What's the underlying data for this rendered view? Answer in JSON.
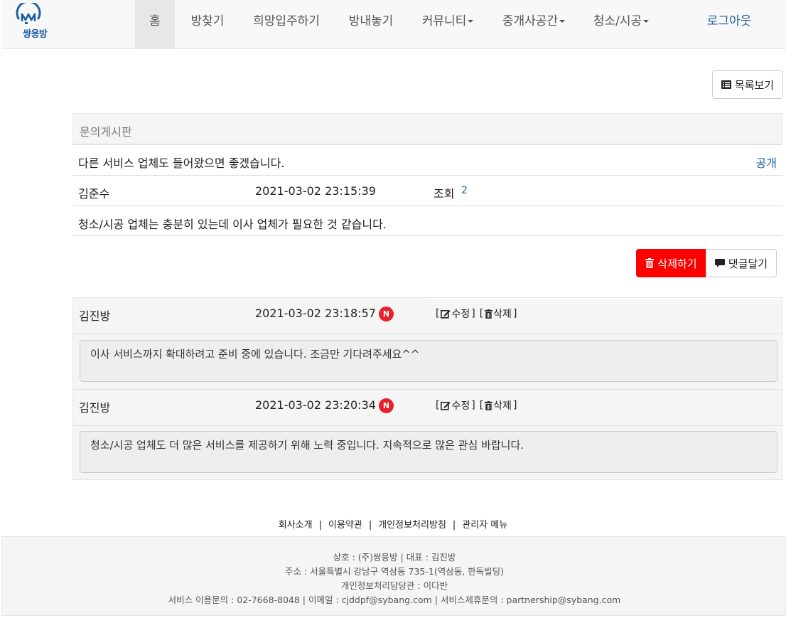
{
  "brand": {
    "name": "쌍용방"
  },
  "nav": {
    "home": "홈",
    "find_room": "방찾기",
    "wish_move": "희망입주하기",
    "list_room": "방내놓기",
    "community": "커뮤니티",
    "broker": "중개사공간",
    "cleaning": "청소/시공",
    "logout": "로그아웃"
  },
  "toolbar": {
    "list_button": "목록보기"
  },
  "post": {
    "board_name": "문의게시판",
    "title": "다른 서비스 업체도 들어왔으면 좋겠습니다.",
    "visibility": "공개",
    "author": "김준수",
    "datetime": "2021-03-02 23:15:39",
    "views_label": "조회",
    "views": "2",
    "content": "청소/시공 업체는 충분히 있는데 이사 업체가 필요한 것 같습니다."
  },
  "actions": {
    "delete": "삭제하기",
    "comment": "댓글달기"
  },
  "comments": [
    {
      "author": "김진방",
      "datetime": "2021-03-02 23:18:57",
      "badge": "N",
      "edit": "수정",
      "delete": "삭제",
      "content": "이사 서비스까지 확대하려고 준비 중에 있습니다. 조금만 기다려주세요^^"
    },
    {
      "author": "김진방",
      "datetime": "2021-03-02 23:20:34",
      "badge": "N",
      "edit": "수정",
      "delete": "삭제",
      "content": "청소/시공 업체도 더 많은 서비스를 제공하기 위해 노력 중입니다. 지속적으로 많은 관심 바랍니다."
    }
  ],
  "footer": {
    "links": [
      "회사소개",
      "이용약관",
      "개인정보처리방침",
      "관리자 메뉴"
    ],
    "line1": "상호 : (주)쌍용방 | 대표 : 김진방",
    "line2": "주소 : 서울특별시 강남구 역삼동 735-1(역삼동, 한독빌딩)",
    "line3": "개인정보처리담당관 : 이다반",
    "line4": "서비스 이용문의 : 02-7668-8048 | 이메일 : cjddpf@sybang.com | 서비스제휴문의 : partnership@sybang.com"
  },
  "colors": {
    "brand_blue": "#1f5fa3",
    "delete_red": "#ff0000",
    "badge_red": "#e8202a",
    "link_blue": "#1f5fa3"
  },
  "icons": [
    "house-logo-icon",
    "list-icon",
    "trash-icon",
    "comment-icon",
    "edit-icon"
  ]
}
